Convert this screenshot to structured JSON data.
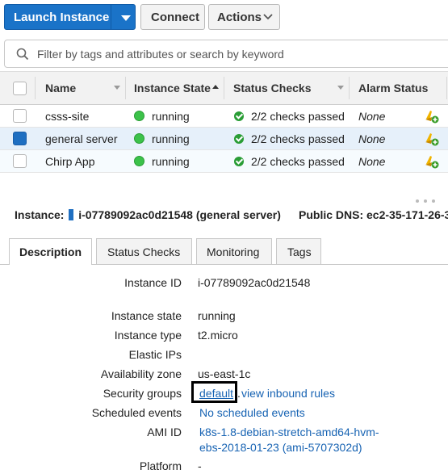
{
  "toolbar": {
    "launch_label": "Launch Instance",
    "connect_label": "Connect",
    "actions_label": "Actions"
  },
  "search": {
    "placeholder": "Filter by tags and attributes or search by keyword"
  },
  "table": {
    "columns": [
      "Name",
      "Instance State",
      "Status Checks",
      "Alarm Status"
    ],
    "rows": [
      {
        "name": "csss-site",
        "state": "running",
        "checks": "2/2 checks passed",
        "alarm": "None",
        "selected": false
      },
      {
        "name": "general server",
        "state": "running",
        "checks": "2/2 checks passed",
        "alarm": "None",
        "selected": true
      },
      {
        "name": "Chirp App",
        "state": "running",
        "checks": "2/2 checks passed",
        "alarm": "None",
        "selected": false
      }
    ]
  },
  "detail": {
    "instance_label": "Instance:",
    "instance_value": "i-07789092ac0d21548 (general server)",
    "dns_label": "Public DNS:",
    "dns_value": "ec2-35-171-26-3",
    "tabs": [
      "Description",
      "Status Checks",
      "Monitoring",
      "Tags"
    ],
    "fields": {
      "instance_id_k": "Instance ID",
      "instance_id_v": "i-07789092ac0d21548",
      "state_k": "Instance state",
      "state_v": "running",
      "type_k": "Instance type",
      "type_v": "t2.micro",
      "eip_k": "Elastic IPs",
      "az_k": "Availability zone",
      "az_v": "us-east-1c",
      "sg_k": "Security groups",
      "sg_link": "default",
      "sg_sep": ".",
      "sg_rules": "view inbound rules",
      "events_k": "Scheduled events",
      "events_v": "No scheduled events",
      "ami_k": "AMI ID",
      "ami_v1": "k8s-1.8-debian-stretch-amd64-hvm-",
      "ami_v2": "ebs-2018-01-23 (ami-5707302d)",
      "platform_k": "Platform",
      "platform_v": "-"
    }
  },
  "colors": {
    "primary": "#1a73c8",
    "link": "#1763b3",
    "ok": "#2a9d36",
    "selected_row": "#e6f0fa"
  }
}
